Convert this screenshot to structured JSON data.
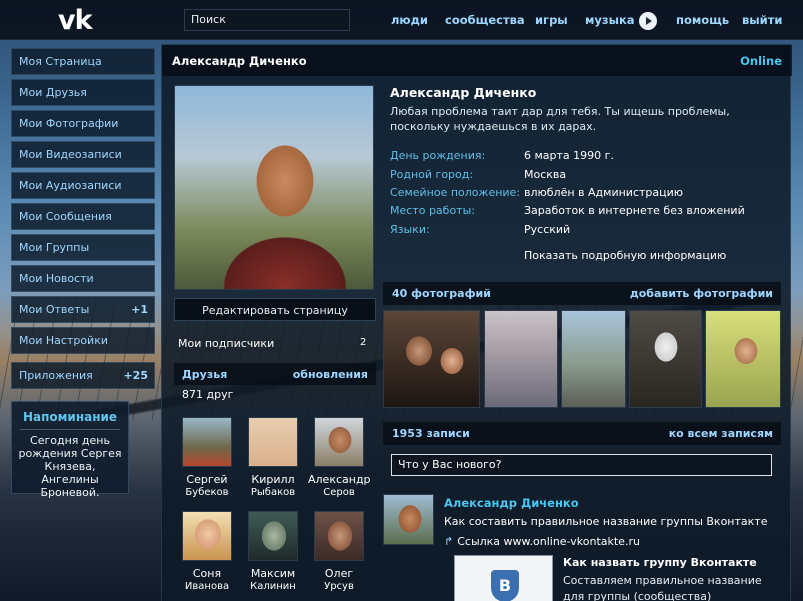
{
  "top": {
    "logo": "vk",
    "search_value": "Поиск",
    "nav": [
      "люди",
      "сообщества",
      "игры",
      "музыка",
      "помощь",
      "выйти"
    ]
  },
  "menu": {
    "items": [
      {
        "label": "Моя Страница",
        "badge": ""
      },
      {
        "label": "Мои Друзья",
        "badge": ""
      },
      {
        "label": "Мои Фотографии",
        "badge": ""
      },
      {
        "label": "Мои Видеозаписи",
        "badge": ""
      },
      {
        "label": "Мои Аудиозаписи",
        "badge": ""
      },
      {
        "label": "Мои Сообщения",
        "badge": ""
      },
      {
        "label": "Мои Группы",
        "badge": ""
      },
      {
        "label": "Мои Новости",
        "badge": ""
      },
      {
        "label": "Мои Ответы",
        "badge": "+1"
      },
      {
        "label": "Мои Настройки",
        "badge": ""
      },
      {
        "label": "Приложения",
        "badge": "+25"
      }
    ]
  },
  "reminder": {
    "title": "Напоминание",
    "text": "Сегодня день рождения Сергея Князева, Ангелины Броневой."
  },
  "profile": {
    "header_name": "Александр Диченко",
    "online": "Online",
    "name": "Александр Диченко",
    "status": "Любая проблема таит дар для тебя. Ты ищешь проблемы, поскольку нуждаешься в их дарах.",
    "fields": [
      {
        "key": "День рождения:",
        "value": "6 марта 1990 г."
      },
      {
        "key": "Родной город:",
        "value": "Москва"
      },
      {
        "key": "Семейное положение:",
        "value": "влюблён в Администрацию"
      },
      {
        "key": "Место работы:",
        "value": "Заработок в интернете без вложений"
      },
      {
        "key": "Языки:",
        "value": "Русский"
      }
    ],
    "more_info": "Показать подробную информацию",
    "edit_button": "Редактировать страницу",
    "subscribers_label": "Мои подписчики",
    "subscribers_count": "2"
  },
  "friends": {
    "title": "Друзья",
    "updates": "обновления",
    "count": "871 друг",
    "list": [
      {
        "first": "Сергей",
        "last": "Бубеков"
      },
      {
        "first": "Кирилл",
        "last": "Рыбаков"
      },
      {
        "first": "Александр",
        "last": "Серов"
      },
      {
        "first": "Соня",
        "last": "Иванова"
      },
      {
        "first": "Максим",
        "last": "Калинин"
      },
      {
        "first": "Олег",
        "last": "Урсув"
      }
    ]
  },
  "photos": {
    "title": "40 фотографий",
    "add": "добавить фотографии"
  },
  "wall": {
    "title": "1953 записи",
    "all": "ко всем записям",
    "input_value": "Что у Вас нового?",
    "post": {
      "author": "Александр Диченко",
      "text": "Как составить правильное название группы Вконтакте",
      "link": "Ссылка www.online-vkontakte.ru",
      "attach_logo_letter": "B",
      "attach_title": "Как назвать группу Вконтакте",
      "attach_desc": "Составляем правильное название для группы (сообщества) Вконтакте."
    }
  },
  "colors": {
    "accent": "#9fd6ff",
    "online": "#49c6ef",
    "label": "#5fbfe6",
    "panel": "#0e1a28"
  }
}
